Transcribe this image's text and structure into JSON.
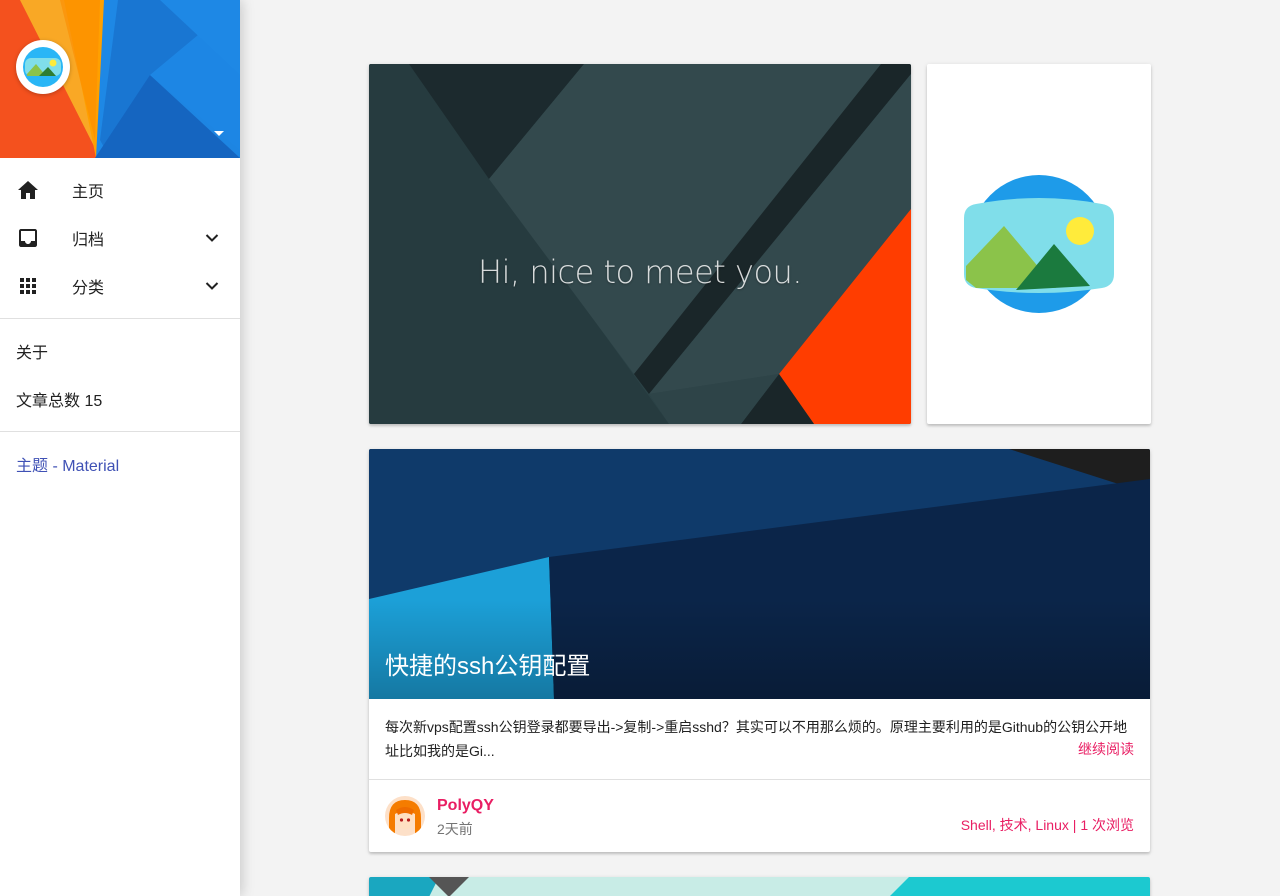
{
  "sidebar": {
    "nav": [
      {
        "label": "主页",
        "icon": "home-icon"
      },
      {
        "label": "归档",
        "icon": "inbox-icon",
        "expandable": true
      },
      {
        "label": "分类",
        "icon": "apps-grid-icon",
        "expandable": true
      }
    ],
    "about": "关于",
    "post_count": "文章总数 15",
    "theme_link": "主题 - Material"
  },
  "hero": {
    "tagline": "Hi, nice to meet you."
  },
  "post": {
    "title": "快捷的ssh公钥配置",
    "excerpt": "每次新vps配置ssh公钥登录都要导出->复制->重启sshd？其实可以不用那么烦的。原理主要利用的是Github的公钥公开地址比如我的是Gi...",
    "read_more": "继续阅读",
    "author": "PolyQY",
    "time": "2天前",
    "tags": "Shell, 技术, Linux",
    "separator": " | ",
    "views": "1 次浏览"
  },
  "colors": {
    "accent": "#e91e63",
    "primary_link": "#3f51b5"
  }
}
